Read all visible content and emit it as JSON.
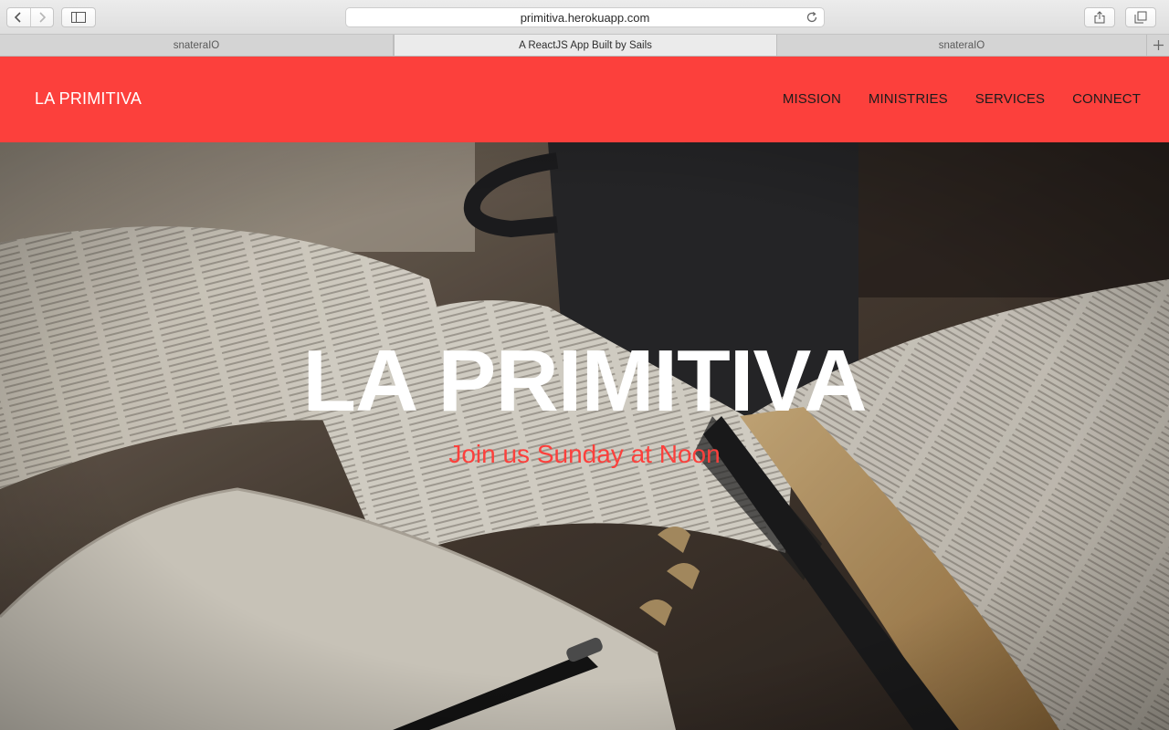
{
  "browser": {
    "url": "primitiva.herokuapp.com",
    "tabs": [
      {
        "label": "snateraIO"
      },
      {
        "label": "A ReactJS App Built by Sails"
      },
      {
        "label": "snateraIO"
      }
    ]
  },
  "site": {
    "brand": "LA PRIMITIVA",
    "nav": [
      {
        "label": "MISSION"
      },
      {
        "label": "MINISTRIES"
      },
      {
        "label": "SERVICES"
      },
      {
        "label": "CONNECT"
      }
    ],
    "hero": {
      "title": "LA PRIMITIVA",
      "subtitle": "Join us Sunday at Noon"
    }
  },
  "colors": {
    "header_bg": "#fc403c",
    "subtitle": "#fc403c"
  }
}
